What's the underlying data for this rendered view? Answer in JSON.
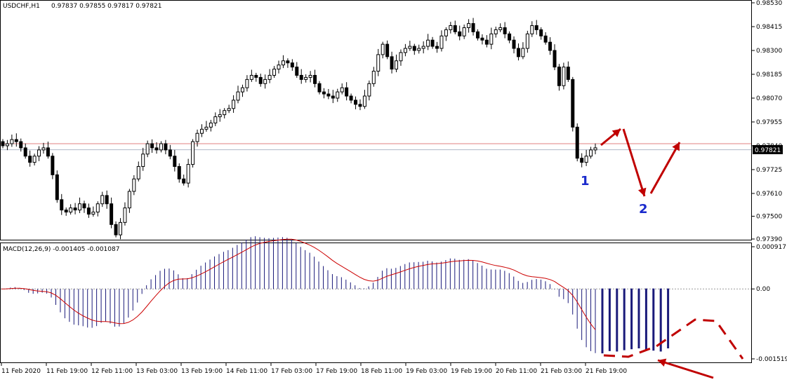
{
  "chart_data": [
    {
      "type": "candlestick",
      "symbol_header": "USDCHF,H1",
      "ohlc_header": "0.97837 0.97855 0.97817 0.97821",
      "price_axis_ticks": [
        "0.98530",
        "0.98415",
        "0.98300",
        "0.98185",
        "0.98070",
        "0.97955",
        "0.97840",
        "0.97725",
        "0.97610",
        "0.97500",
        "0.97390"
      ],
      "current_price_label": "0.97821",
      "ylim": [
        0.9739,
        0.9853
      ],
      "close_series": [
        0.9784,
        0.9785,
        0.9787,
        0.9786,
        0.9783,
        0.9779,
        0.9776,
        0.9779,
        0.9782,
        0.9783,
        0.9779,
        0.977,
        0.9758,
        0.9753,
        0.9752,
        0.9754,
        0.9753,
        0.9756,
        0.9754,
        0.9751,
        0.9752,
        0.9756,
        0.976,
        0.9756,
        0.9746,
        0.9741,
        0.9747,
        0.9754,
        0.9762,
        0.9768,
        0.9774,
        0.978,
        0.9785,
        0.9783,
        0.9782,
        0.9785,
        0.9782,
        0.9779,
        0.9774,
        0.9768,
        0.9766,
        0.9775,
        0.9786,
        0.979,
        0.9792,
        0.9793,
        0.9795,
        0.9798,
        0.9799,
        0.9801,
        0.9802,
        0.9806,
        0.981,
        0.9812,
        0.9816,
        0.9818,
        0.9817,
        0.9814,
        0.9816,
        0.9818,
        0.9821,
        0.9823,
        0.9825,
        0.9824,
        0.9822,
        0.9818,
        0.9816,
        0.9817,
        0.9818,
        0.9814,
        0.981,
        0.9809,
        0.9808,
        0.9807,
        0.981,
        0.9812,
        0.9808,
        0.9806,
        0.9804,
        0.9803,
        0.9808,
        0.9814,
        0.982,
        0.9828,
        0.9833,
        0.9827,
        0.9821,
        0.9825,
        0.9829,
        0.9831,
        0.9832,
        0.983,
        0.9831,
        0.9832,
        0.9835,
        0.9832,
        0.9831,
        0.9837,
        0.984,
        0.9842,
        0.9839,
        0.9837,
        0.9841,
        0.9843,
        0.9839,
        0.9836,
        0.9835,
        0.9833,
        0.9838,
        0.984,
        0.9841,
        0.9838,
        0.9835,
        0.9831,
        0.9827,
        0.9831,
        0.9838,
        0.9842,
        0.984,
        0.9837,
        0.9834,
        0.983,
        0.9822,
        0.9813,
        0.9822,
        0.9816,
        0.9793,
        0.9778,
        0.9776,
        0.9779,
        0.9782,
        0.9783
      ],
      "sub_title": "MACD(12,26,9) -0.001405 -0.001087",
      "macd_axis_ticks": [
        "0.000917",
        "0.00",
        "-0.001519"
      ],
      "macd_ylim": [
        -0.001519,
        0.000917
      ],
      "macd_extension": [
        -0.0014,
        -0.00135,
        -0.00136,
        -0.00133,
        -0.00131,
        -0.00129,
        -0.00132,
        -0.00134,
        -0.00136,
        -0.00129
      ],
      "time_axis_ticks": [
        "11 Feb 2020",
        "11 Feb 19:00",
        "12 Feb 11:00",
        "13 Feb 03:00",
        "13 Feb 19:00",
        "14 Feb 11:00",
        "17 Feb 03:00",
        "17 Feb 19:00",
        "18 Feb 11:00",
        "19 Feb 03:00",
        "19 Feb 19:00",
        "20 Feb 11:00",
        "21 Feb 03:00",
        "21 Feb 19:00"
      ],
      "annotations": [
        "1",
        "2"
      ],
      "colors": {
        "candle": "#000000",
        "bid_line": "#e08080",
        "ask_line": "#b0b8c8",
        "macd_hist": "#1a1a7a",
        "macd_signal": "#cc0000",
        "arrow": "#c00000",
        "label_blue": "#1a2acc",
        "price_box": "#000000"
      }
    }
  ]
}
